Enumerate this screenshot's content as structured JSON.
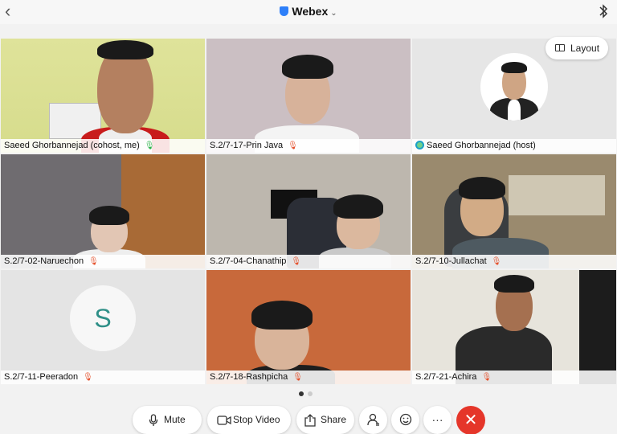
{
  "app": {
    "title": "Webex",
    "back_label": "‹",
    "title_chevron": "⌄"
  },
  "layout_button": {
    "label": "Layout"
  },
  "tiles": [
    {
      "name": "Saeed Ghorbannejad (cohost, me)",
      "mic": "on",
      "active": true
    },
    {
      "name": "S.2/7-17-Prin Java",
      "mic": "off"
    },
    {
      "name": "Saeed Ghorbannejad (host)",
      "mic": "none",
      "host_badge": true
    },
    {
      "name": "S.2/7-02-Naruechon",
      "mic": "off"
    },
    {
      "name": "S.2/7-04-Chanathip",
      "mic": "off"
    },
    {
      "name": "S.2/7-10-Jullachat",
      "mic": "off"
    },
    {
      "name": "S.2/7-11-Peeradon",
      "mic": "off",
      "avatar_letter": "S"
    },
    {
      "name": "S.2/7-18-Rashpicha",
      "mic": "off"
    },
    {
      "name": "S.2/7-21-Achira",
      "mic": "off"
    }
  ],
  "pagination": {
    "current": 1,
    "total": 2
  },
  "controls": {
    "mute_label": "Mute",
    "stop_video_label": "Stop Video",
    "share_label": "Share",
    "participants_icon": "participants-icon",
    "reactions_icon": "emoji-icon",
    "more_label": "···",
    "end_label": "✕"
  },
  "colors": {
    "accent": "#2d7ff9",
    "end_call": "#e5362a",
    "muted_mic": "#e5502b",
    "active_mic": "#2bb34a",
    "active_border": "#1aa0c7"
  }
}
